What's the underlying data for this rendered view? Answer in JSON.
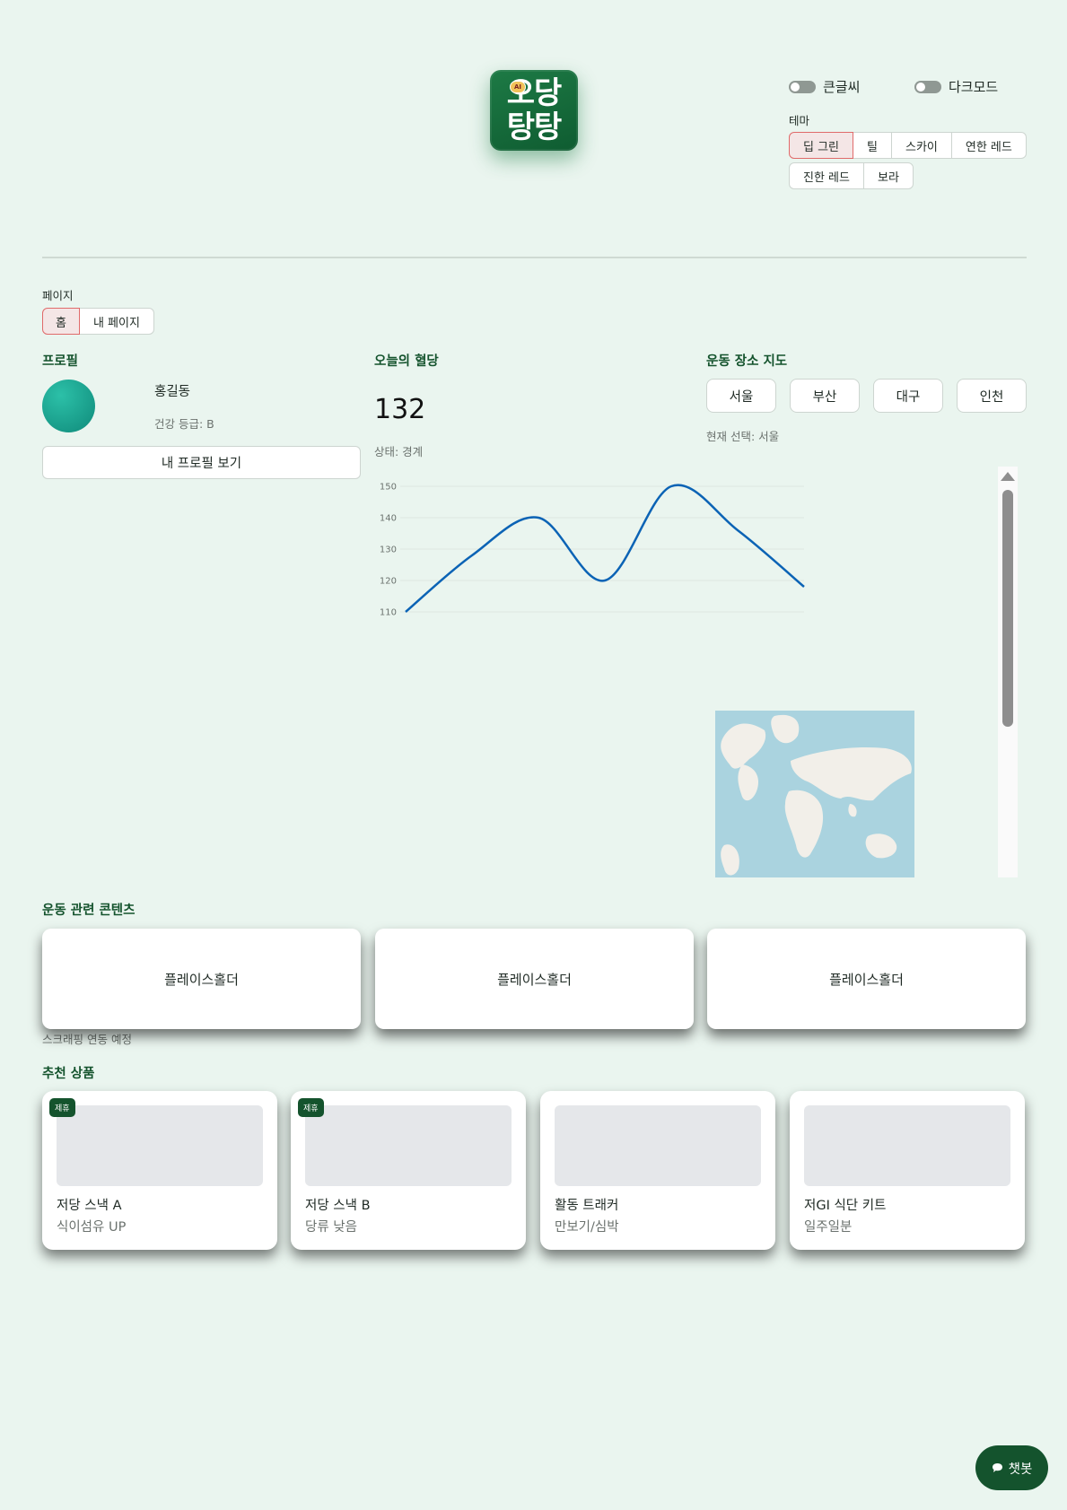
{
  "logo": {
    "line1": "오당",
    "line2": "탕탕",
    "badge": "AI"
  },
  "toggles": {
    "large_text": {
      "label": "큰글씨",
      "on": false
    },
    "dark_mode": {
      "label": "다크모드",
      "on": false
    }
  },
  "theme": {
    "label": "테마",
    "options": [
      "딥 그린",
      "틸",
      "스카이",
      "연한 레드",
      "진한 레드",
      "보라"
    ],
    "selected": "딥 그린"
  },
  "page_nav": {
    "label": "페이지",
    "options": [
      "홈",
      "내 페이지"
    ],
    "selected": "홈"
  },
  "profile": {
    "title": "프로필",
    "name": "홍길동",
    "grade": "건강 등급: B",
    "button": "내 프로필 보기"
  },
  "glucose": {
    "title": "오늘의 혈당",
    "value": "132",
    "status": "상태: 경계"
  },
  "chart_data": {
    "type": "line",
    "x": [
      0,
      1,
      2,
      3,
      4,
      5,
      6
    ],
    "series": [
      {
        "values": [
          110,
          128,
          140,
          120,
          150,
          136,
          118
        ]
      }
    ],
    "yticks": [
      110,
      120,
      130,
      140,
      150
    ],
    "ylim": [
      110,
      150
    ],
    "grid": true,
    "color": "#0b63b5"
  },
  "map_section": {
    "title": "운동 장소 지도",
    "cities": [
      "서울",
      "부산",
      "대구",
      "인천"
    ],
    "current": "현재 선택: 서울"
  },
  "contents": {
    "title": "운동 관련 콘텐츠",
    "cards": [
      "플레이스홀더",
      "플레이스홀더",
      "플레이스홀더"
    ],
    "note": "스크래핑 연동 예정"
  },
  "products": {
    "title": "추천 상품",
    "items": [
      {
        "name": "저당 스낵 A",
        "desc": "식이섬유 UP",
        "badge": "제휴"
      },
      {
        "name": "저당 스낵 B",
        "desc": "당류 낮음",
        "badge": "제휴"
      },
      {
        "name": "활동 트래커",
        "desc": "만보기/심박",
        "badge": ""
      },
      {
        "name": "저GI 식단 키트",
        "desc": "일주일분",
        "badge": ""
      }
    ]
  },
  "chatbot": {
    "icon": "speech-bubble-icon",
    "label": "챗봇"
  },
  "colors": {
    "accent": "#14532d",
    "background": "#eaf5ef",
    "active_border": "#e06a6a"
  }
}
